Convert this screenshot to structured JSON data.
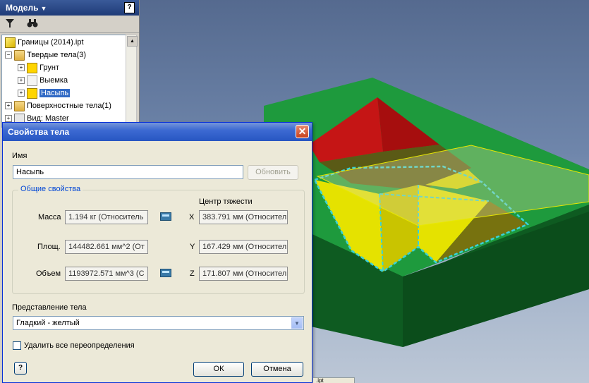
{
  "browser": {
    "title": "Модель",
    "help": "?",
    "tree": [
      {
        "label": "Границы (2014).ipt",
        "icon": "part-icon"
      },
      {
        "label": "Твердые тела(3)",
        "icon": "folder-icon"
      },
      {
        "label": "Грунт",
        "icon": "solid-body-yellow-icon"
      },
      {
        "label": "Выемка",
        "icon": "solid-body-white-icon"
      },
      {
        "label": "Насыпь",
        "icon": "solid-body-yellow-icon"
      },
      {
        "label": "Поверхностные тела(1)",
        "icon": "folder-icon"
      },
      {
        "label": "Вид: Master",
        "icon": "view-icon"
      }
    ]
  },
  "dialog": {
    "title": "Свойства тела",
    "name_label": "Имя",
    "name_value": "Насыпь",
    "update_button": "Обновить",
    "group_title": "Общие свойства",
    "mass_label": "Масса",
    "mass_value": "1.194 кг (Относитель",
    "area_label": "Площ.",
    "area_value": "144482.661 мм^2 (От",
    "volume_label": "Объем",
    "volume_value": "1193972.571 мм^3 (С",
    "cog_label": "Центр тяжести",
    "x_label": "X",
    "x_value": "383.791 мм (Относител",
    "y_label": "Y",
    "y_value": "167.429 мм (Относител",
    "z_label": "Z",
    "z_value": "171.807 мм (Относител",
    "representation_label": "Представление тела",
    "representation_value": "Гладкий - желтый",
    "override_label": "Удалить все переопределения",
    "help_label": "?",
    "ok_button": "ОК",
    "cancel_button": "Отмена"
  },
  "doc_tab": {
    "label": ".ipt"
  },
  "colors": {
    "model_green": "#1f9a3c",
    "model_side": "#0d5e22",
    "cut_red": "#c01010",
    "fill_yellow": "#e6e200",
    "selection_cyan": "#35d0d8"
  }
}
